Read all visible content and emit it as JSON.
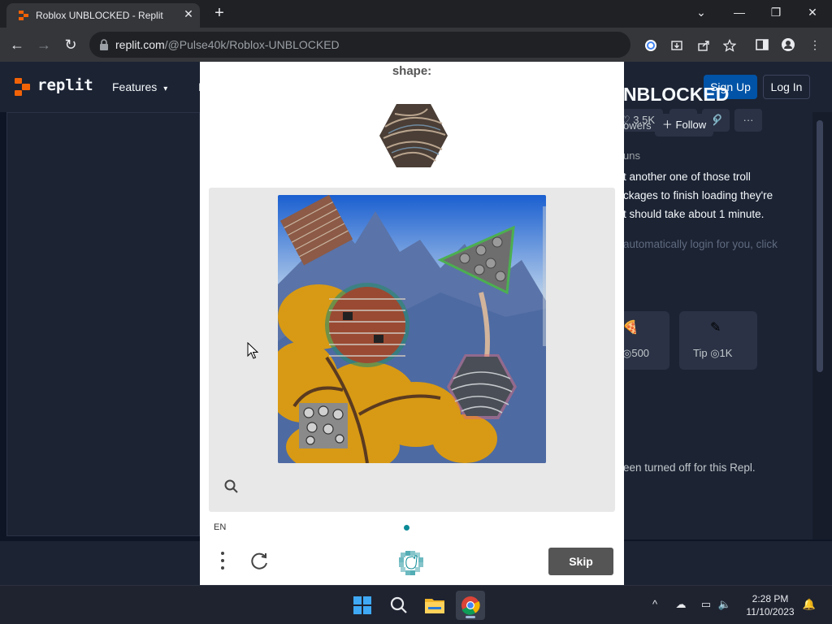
{
  "browser": {
    "tab_title": "Roblox UNBLOCKED - Replit",
    "url_host": "replit.com",
    "url_path": "/@Pulse40k/Roblox-UNBLOCKED"
  },
  "replit": {
    "logo_text": "replit",
    "nav_features": "Features",
    "nav_partial": "I",
    "sign_up": "Sign Up",
    "log_in": "Log In",
    "likes": "3.5K",
    "title": "NBLOCKED",
    "followers": "owers",
    "follow": "Follow",
    "runs": "uns",
    "description": "t another one of those troll\nckages to finish loading they're\nt should take about 1 minute.",
    "description_faded": "automatically login for you, click",
    "tip1_amount": "500",
    "tip2_label": "Tip",
    "tip2_amount": "1K",
    "disabled_note": "een turned off for this Repl."
  },
  "captcha": {
    "prompt": "shape:",
    "language": "EN",
    "skip": "Skip"
  },
  "taskbar": {
    "time": "2:28 PM",
    "date": "11/10/2023"
  },
  "colors": {
    "replit_orange": "#f26207",
    "signup_blue": "#0053a6",
    "captcha_teal": "#0a8a96"
  }
}
